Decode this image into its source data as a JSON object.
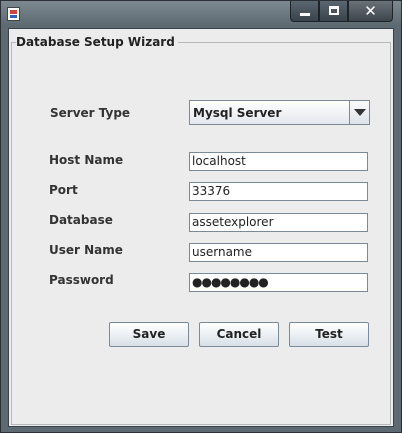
{
  "window": {
    "title": ""
  },
  "dialog": {
    "title": "Database Setup Wizard",
    "server_type": {
      "label": "Server Type",
      "value": "Mysql Server"
    },
    "fields": {
      "host_name": {
        "label": "Host Name",
        "value": "localhost"
      },
      "port": {
        "label": "Port",
        "value": "33376"
      },
      "database": {
        "label": "Database",
        "value": "assetexplorer"
      },
      "user_name": {
        "label": "User Name",
        "value": "username"
      },
      "password": {
        "label": "Password",
        "value": "●●●●●●●●"
      }
    },
    "buttons": {
      "save": "Save",
      "cancel": "Cancel",
      "test": "Test"
    }
  },
  "icons": {
    "app": "java-app-icon",
    "minimize": "minimize-icon",
    "maximize": "maximize-icon",
    "close": "close-icon",
    "dropdown": "chevron-down-icon"
  }
}
